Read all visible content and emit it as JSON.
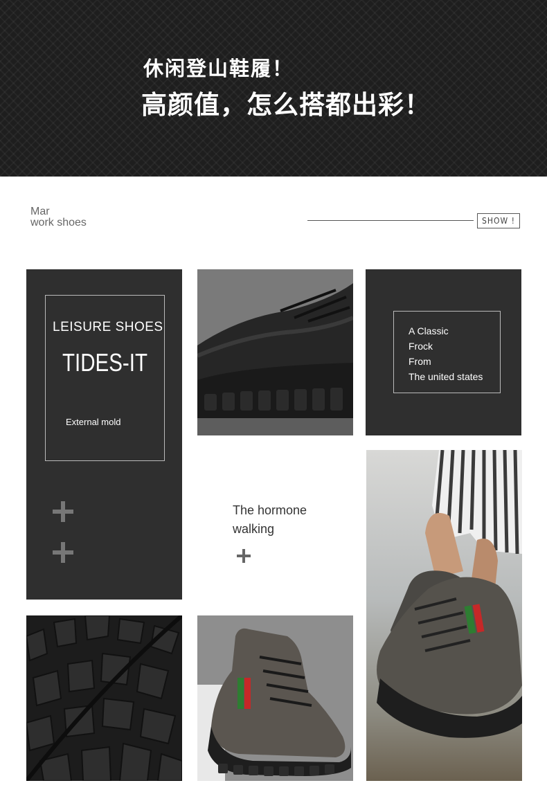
{
  "banner": {
    "line1": "休闲登山鞋履！",
    "line2": "高颜值，怎么搭都出彩！"
  },
  "section": {
    "title_line1": "Mar",
    "title_line2": "work shoes",
    "show_button": "SHOW !"
  },
  "tile_left": {
    "category": "LEISURE SHOES",
    "brand": "TIDES-IT",
    "caption": "External mold"
  },
  "tile_right": {
    "lines": [
      "A Classic",
      "Frock",
      "From",
      "The united states"
    ]
  },
  "tile_middle": {
    "line1": "The hormone",
    "line2": "walking"
  },
  "colors": {
    "banner_bg": "#1e1e1e",
    "tile_dark": "#2f2f2f",
    "accent_red": "#c62828",
    "accent_green": "#2e7d32"
  }
}
